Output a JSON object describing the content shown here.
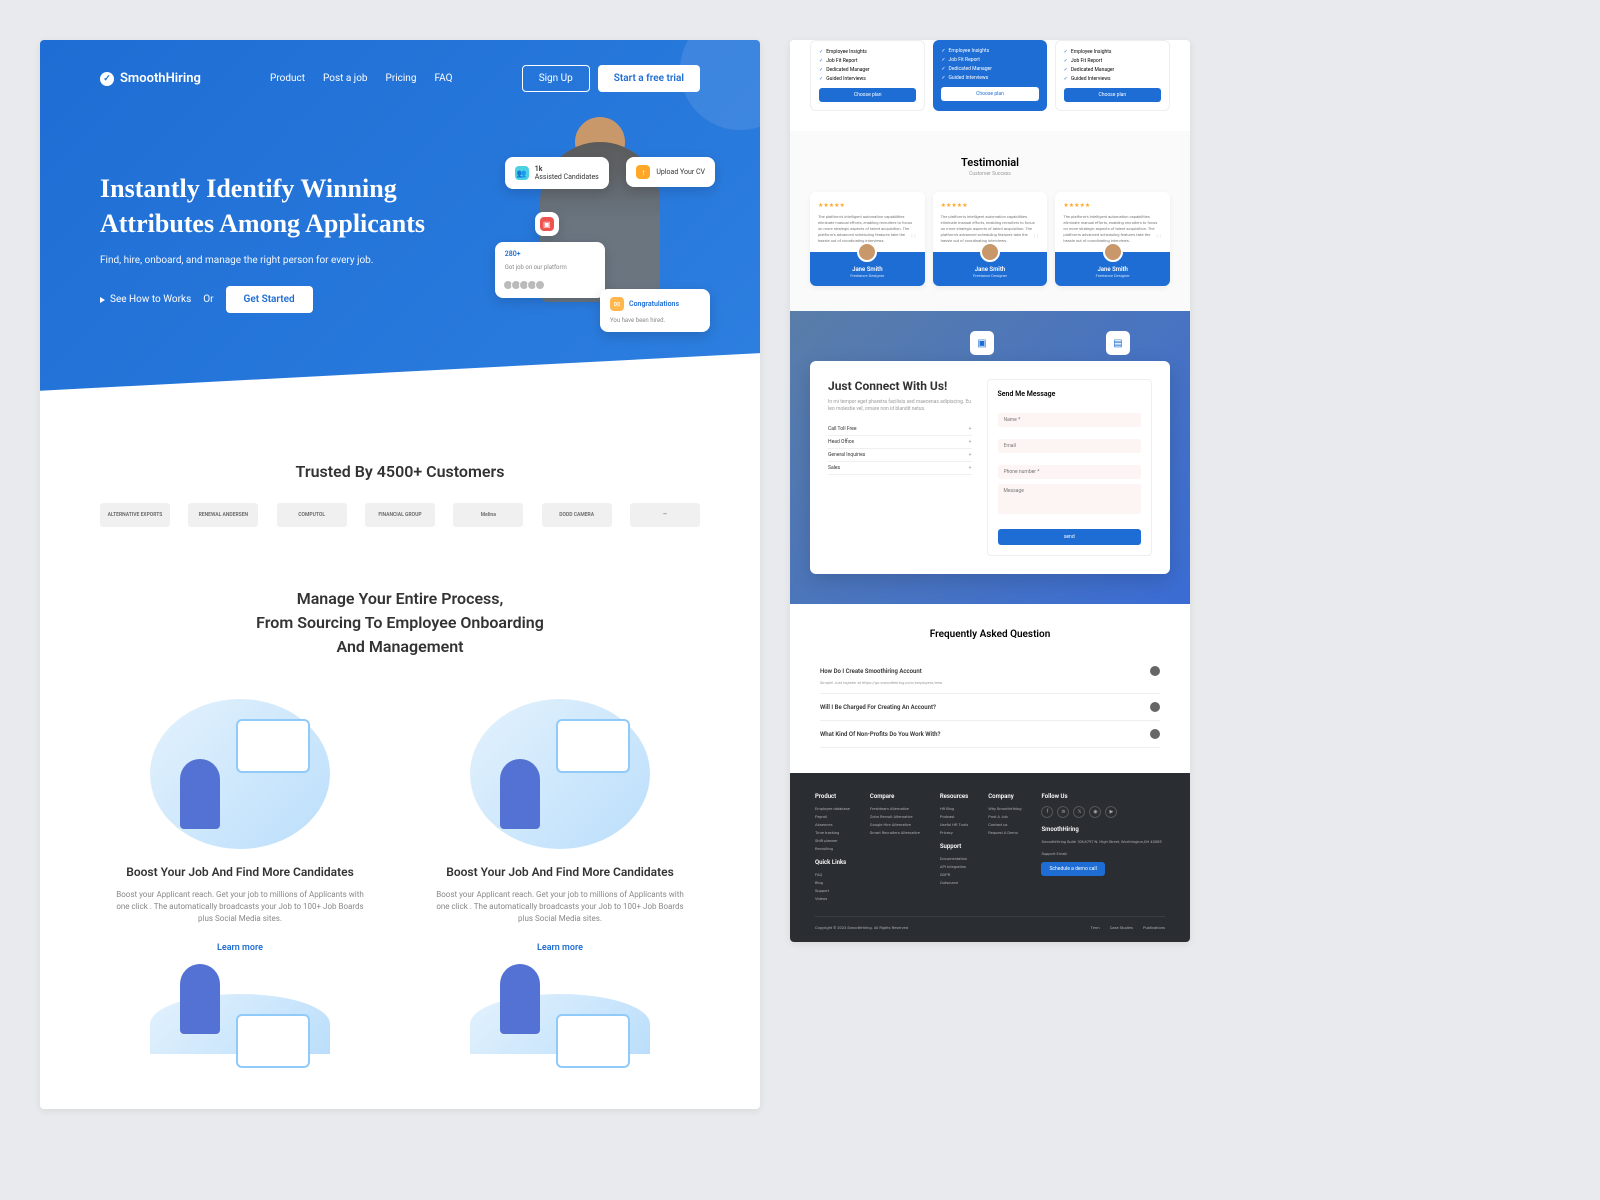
{
  "brand": "SmoothHiring",
  "nav": {
    "links": [
      "Product",
      "Post a job",
      "Pricing",
      "FAQ"
    ],
    "signup": "Sign Up",
    "trial": "Start a free trial"
  },
  "hero": {
    "title": "Instantly Identify Winning Attributes Among Applicants",
    "subtitle": "Find, hire, onboard, and manage the right person for every job.",
    "how": "See How to Works",
    "or": "Or",
    "start": "Get Started",
    "cards": {
      "assisted": {
        "count": "1k",
        "label": "Assisted Candidates"
      },
      "upload": "Upload Your CV",
      "platform": {
        "count": "280+",
        "label": "Got job on our platform"
      },
      "congrats": {
        "title": "Congratulations",
        "sub": "You have been hired."
      }
    }
  },
  "trusted": {
    "title": "Trusted By 4500+ Customers",
    "logos": [
      "ALTERNATIVE EXPORTS",
      "RENEWAL ANDERSEN",
      "COMPUTOL",
      "FINANCIAL GROUP",
      "Melina",
      "DODD CAMERA",
      "—"
    ]
  },
  "features": {
    "title": "Manage Your Entire Process,\nFrom Sourcing To Employee Onboarding\nAnd Management",
    "card": {
      "title": "Boost Your Job And Find More Candidates",
      "desc": "Boost your Applicant reach. Get your job to millions of Applicants with one click . The automatically broadcasts your Job to 100+ Job Boards plus Social Media sites.",
      "link": "Learn more"
    }
  },
  "pricing": {
    "features": [
      "Employee Insights",
      "Job Fit Report",
      "Dedicated Manager",
      "Guided Interviews"
    ],
    "btn": "Choose plan"
  },
  "testimonials": {
    "title": "Testimonial",
    "sub": "Customer Success",
    "text": "The platform's intelligent automation capabilities eliminate manual efforts, enabling recruiters to focus on more strategic aspects of talent acquisition. The platform's advanced scheduling features take the hassle out of coordinating interviews.",
    "name": "Jane Smith",
    "role": "Freelance Designer"
  },
  "contact": {
    "title": "Just Connect With Us!",
    "desc": "In mi tempor eget pharetra facilisis sed maecenas adipiscing. Eu leo molestie vel, ornare non id blandit netus.",
    "items": [
      "Call Toll Free",
      "Head Office",
      "General Inquiries",
      "Sales"
    ],
    "form": {
      "title": "Send Me Message",
      "name": "Name *",
      "email": "Email",
      "phone": "Phone number *",
      "msg": "Message",
      "send": "send"
    }
  },
  "faq": {
    "title": "Frequently Asked Question",
    "items": [
      {
        "q": "How Do I Create Smoothiring Account",
        "a": "Simple! Just register at https://go.smoothhiring.com/employers/new"
      },
      {
        "q": "Will I Be Charged For Creating An Account?"
      },
      {
        "q": "What Kind Of Non-Profits Do You Work With?"
      }
    ]
  },
  "footer": {
    "product": {
      "title": "Product",
      "links": [
        "Employee database",
        "Payroll",
        "Absences",
        "Time tracking",
        "Shift planner",
        "Recruiting"
      ]
    },
    "quick": {
      "title": "Quick Links",
      "links": [
        "FAQ",
        "Blog",
        "Support",
        "Videos"
      ]
    },
    "compare": {
      "title": "Compare",
      "links": [
        "Freshteam Alternative",
        "Zoho Recruit Alternative",
        "Google Hire Alternative",
        "Smart Recruiters Alternative"
      ]
    },
    "resources": {
      "title": "Resources",
      "links": [
        "HR Blog",
        "Podcast",
        "Useful HR Tools",
        "Privacy"
      ]
    },
    "support": {
      "title": "Support",
      "links": [
        "Documentation",
        "API Integration",
        "GDPR",
        "Outsource"
      ]
    },
    "company": {
      "title": "Company",
      "links": [
        "Why SmoothHiring",
        "Post A Job",
        "Contact us",
        "Request A Demo"
      ]
    },
    "follow": "Follow Us",
    "brand": "SmoothHiring",
    "addr": "SmoothHiring Suite 106,6797 N. High Street, Worthington,OH 43085",
    "support_email": "Support Email:",
    "schedule": "Schedule a demo call",
    "copyright": "Copyright © 2023 SmoothHiring. All Rights Reserved",
    "bottom_links": [
      "Term",
      "Case Studies",
      "Publications"
    ]
  }
}
